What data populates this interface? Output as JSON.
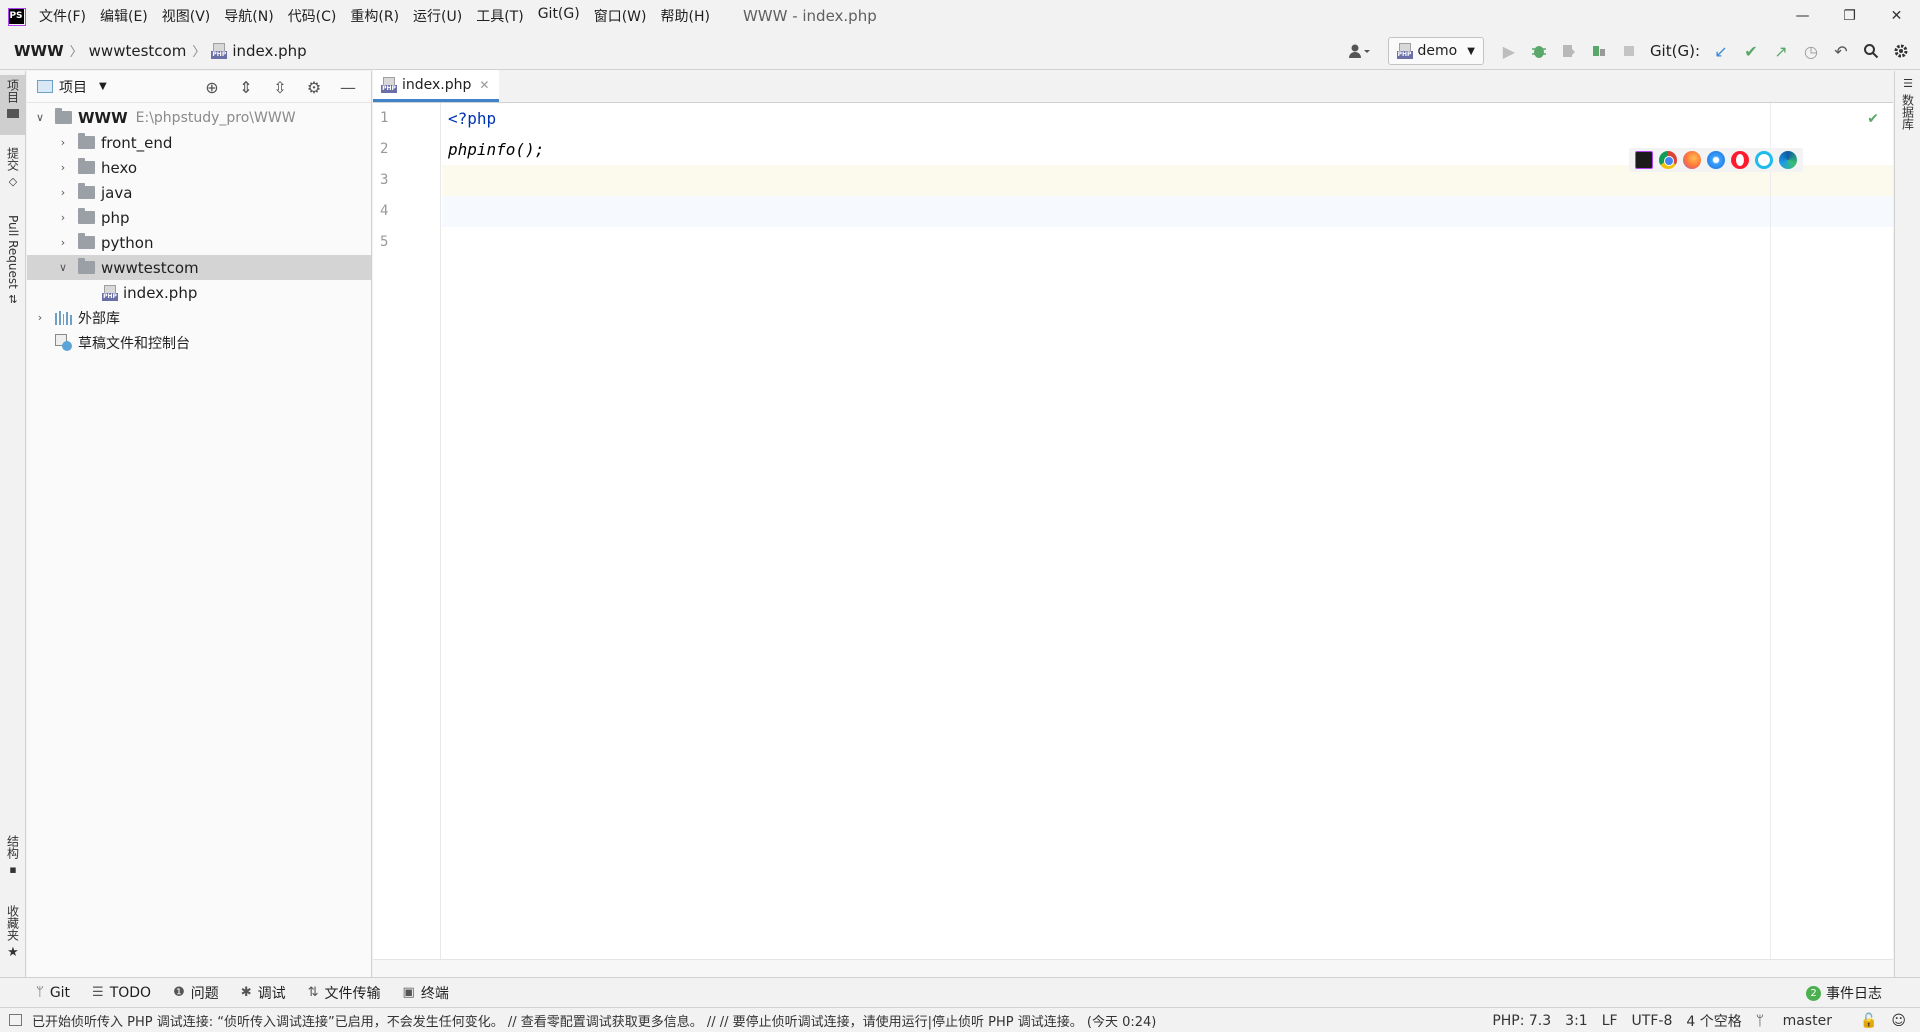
{
  "app": {
    "logo_text": "PS",
    "window_title": "WWW - index.php"
  },
  "menu": [
    "文件(F)",
    "编辑(E)",
    "视图(V)",
    "导航(N)",
    "代码(C)",
    "重构(R)",
    "运行(U)",
    "工具(T)",
    "Git(G)",
    "窗口(W)",
    "帮助(H)"
  ],
  "window_controls": {
    "minimize": "—",
    "restore": "❐",
    "close": "✕"
  },
  "breadcrumb": {
    "root": "WWW",
    "folder": "wwwtestcom",
    "file": "index.php",
    "separator": "〉"
  },
  "run_config": {
    "label": "demo"
  },
  "git": {
    "label": "Git(G):"
  },
  "left_tabs": [
    "项目",
    "提交",
    "Pull Request",
    "结构",
    "收藏夹"
  ],
  "right_tabs": [
    "数据库"
  ],
  "project_panel": {
    "title": "项目",
    "tree": [
      {
        "name": "WWW",
        "path": "E:\\phpstudy_pro\\WWW",
        "expanded": true,
        "type": "folder",
        "depth": 0
      },
      {
        "name": "front_end",
        "type": "folder",
        "depth": 1
      },
      {
        "name": "hexo",
        "type": "folder",
        "depth": 1
      },
      {
        "name": "java",
        "type": "folder",
        "depth": 1
      },
      {
        "name": "php",
        "type": "folder",
        "depth": 1
      },
      {
        "name": "python",
        "type": "folder",
        "depth": 1
      },
      {
        "name": "wwwtestcom",
        "type": "folder",
        "depth": 1,
        "expanded": true,
        "selected": true
      },
      {
        "name": "index.php",
        "type": "php-file",
        "depth": 2
      },
      {
        "name": "外部库",
        "type": "library",
        "depth": 0
      },
      {
        "name": "草稿文件和控制台",
        "type": "scratches",
        "depth": 0
      }
    ]
  },
  "editor": {
    "tab_label": "index.php",
    "line_numbers": [
      "1",
      "2",
      "3",
      "4",
      "5"
    ],
    "code": {
      "line1": "<?php",
      "line2": "phpinfo();"
    }
  },
  "php_badge": "PHP",
  "tool_windows": [
    {
      "icon": "git-branch-icon",
      "glyph": "ᛘ",
      "label": "Git"
    },
    {
      "icon": "todo-icon",
      "glyph": "☰",
      "label": "TODO"
    },
    {
      "icon": "problems-icon",
      "glyph": "❶",
      "label": "问题"
    },
    {
      "icon": "debug-icon",
      "glyph": "✱",
      "label": "调试"
    },
    {
      "icon": "file-transfer-icon",
      "glyph": "⇅",
      "label": "文件传输"
    },
    {
      "icon": "terminal-icon",
      "glyph": "▣",
      "label": "终端"
    }
  ],
  "event_log": {
    "count": "2",
    "label": "事件日志"
  },
  "status": {
    "message": "已开始侦听传入 PHP 调试连接: “侦听传入调试连接”已启用，不会发生任何变化。 // 查看零配置调试获取更多信息。 // // 要停止侦听调试连接，请使用运行|停止侦听 PHP 调试连接。 (今天 0:24)",
    "php_version": "PHP: 7.3",
    "cursor": "3:1",
    "line_sep": "LF",
    "encoding": "UTF-8",
    "indent": "4 个空格",
    "branch": "master"
  }
}
